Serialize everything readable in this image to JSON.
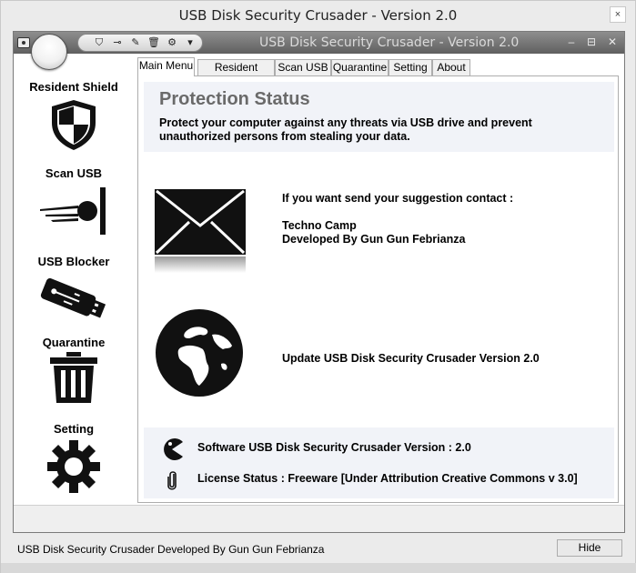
{
  "outer_window": {
    "title": "USB Disk Security Crusader - Version 2.0",
    "close_label": "×"
  },
  "inner_window": {
    "title": "USB Disk Security Crusader - Version 2.0",
    "minimize_label": "–",
    "maximize_label": "⊟",
    "close_label": "✕"
  },
  "quick_access": [
    {
      "name": "shield-quick-icon",
      "glyph": "⛉"
    },
    {
      "name": "scan-quick-icon",
      "glyph": "⊸"
    },
    {
      "name": "usb-quick-icon",
      "glyph": "✎"
    },
    {
      "name": "trash-quick-icon",
      "glyph": "🗑"
    },
    {
      "name": "gear-quick-icon",
      "glyph": "⚙"
    },
    {
      "name": "dropdown-quick-icon",
      "glyph": "▾"
    }
  ],
  "sidebar": {
    "items": [
      {
        "label": "Resident Shield",
        "icon": "shield-icon"
      },
      {
        "label": "Scan USB",
        "icon": "scan-icon"
      },
      {
        "label": "USB Blocker",
        "icon": "usb-drive-icon"
      },
      {
        "label": "Quarantine",
        "icon": "trash-icon"
      },
      {
        "label": "Setting",
        "icon": "gear-icon"
      }
    ]
  },
  "tabs": [
    {
      "label": "Main Menu",
      "active": true
    },
    {
      "label": "Resident Shield",
      "active": false
    },
    {
      "label": "Scan USB",
      "active": false
    },
    {
      "label": "Quarantine",
      "active": false
    },
    {
      "label": "Setting",
      "active": false
    },
    {
      "label": "About",
      "active": false
    }
  ],
  "main": {
    "protection_title": "Protection Status",
    "protection_desc": "Protect your computer against any threats via USB drive and prevent unauthorized persons from stealing your data.",
    "contact_line": "If you want send your suggestion contact :",
    "contact_org": "Techno Camp",
    "contact_dev": "Developed By Gun Gun Febrianza",
    "update_text": "Update USB Disk Security Crusader Version 2.0",
    "software_version": "Software USB Disk Security Crusader Version : 2.0",
    "license_status": "License Status : Freeware [Under Attribution Creative Commons v 3.0]"
  },
  "footer": {
    "status_text": "USB Disk Security Crusader Developed By Gun Gun Febrianza",
    "hide_label": "Hide"
  },
  "colors": {
    "title_gray": "#6a6a6a",
    "info_panel": "#f1f3f8",
    "titlebar_dark": "#6e6e6e"
  }
}
